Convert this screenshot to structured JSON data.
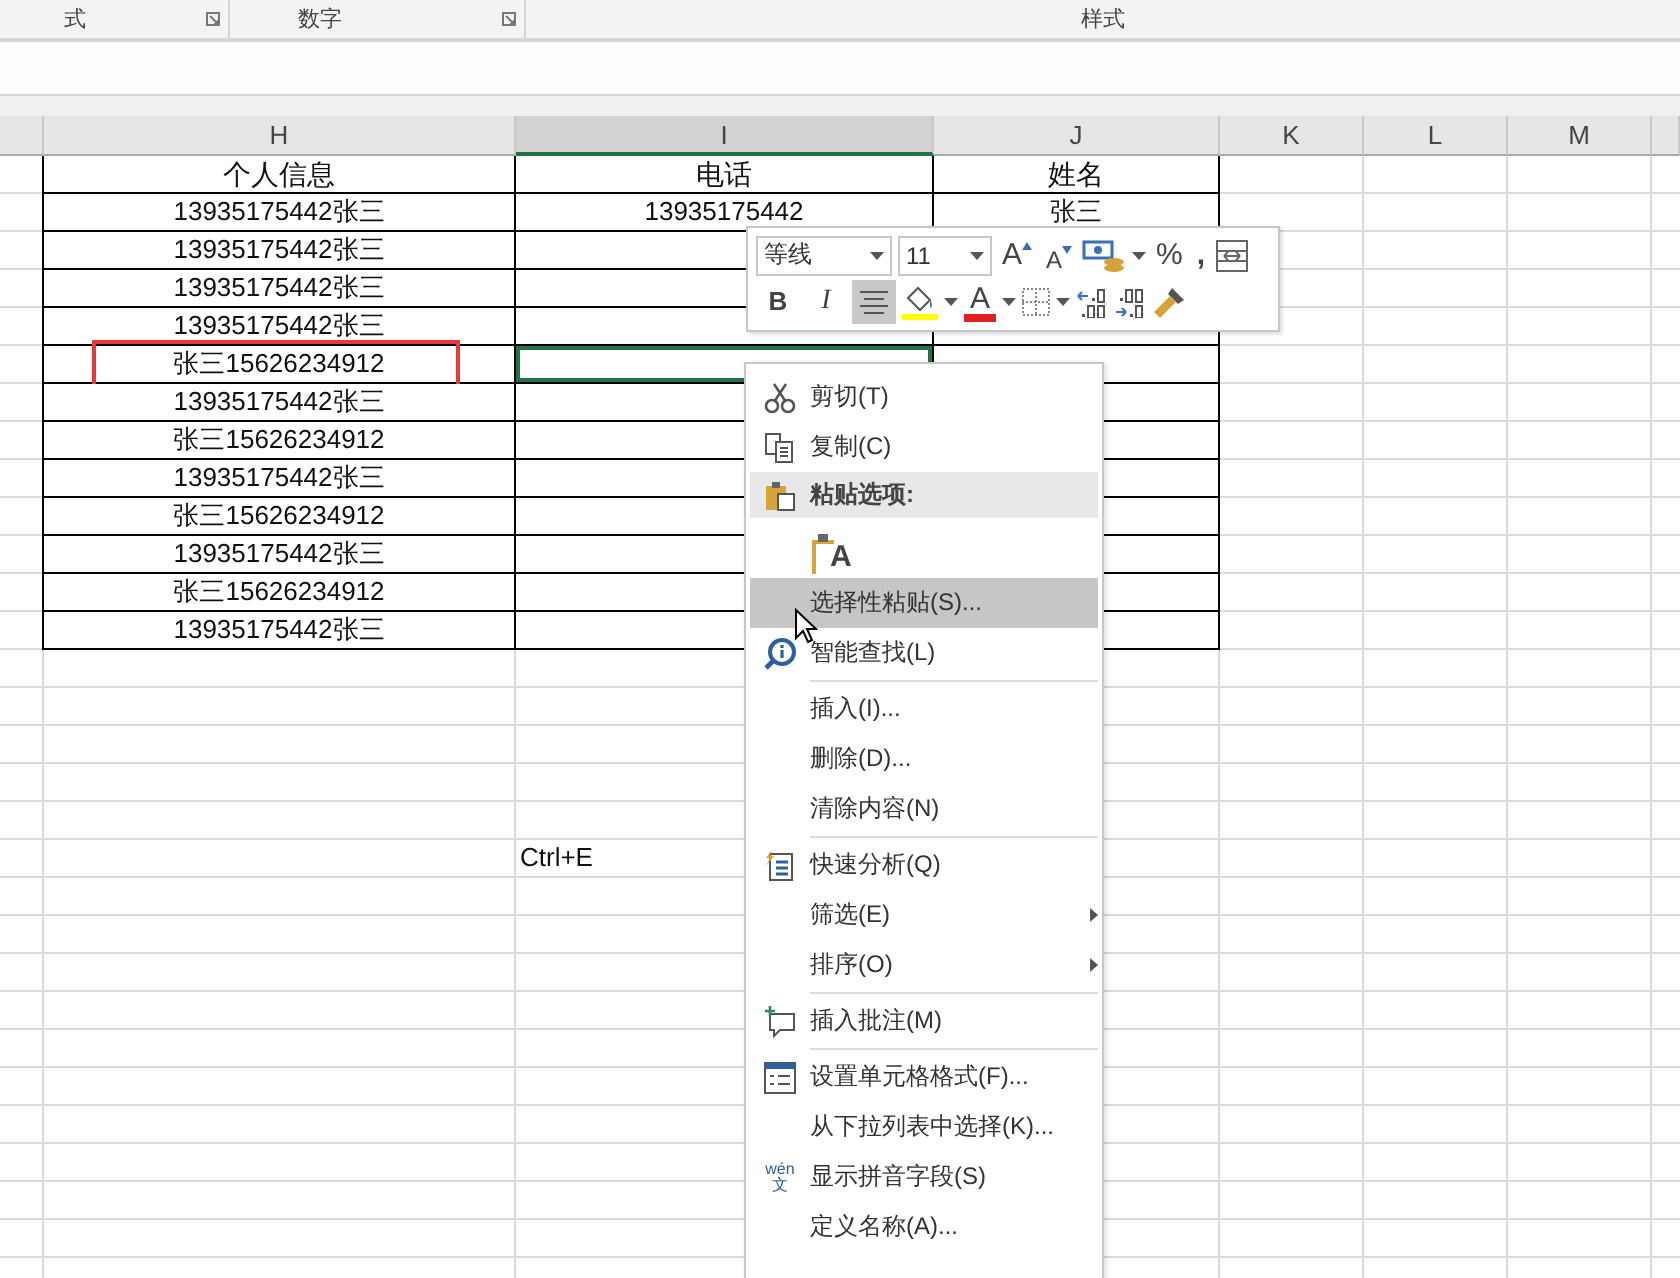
{
  "ribbon_groups": [
    {
      "label": "式"
    },
    {
      "label": "数字"
    },
    {
      "label": "样式"
    }
  ],
  "columns": [
    {
      "label": "H",
      "selected": false
    },
    {
      "label": "I",
      "selected": true
    },
    {
      "label": "J",
      "selected": false
    },
    {
      "label": "K",
      "selected": false
    },
    {
      "label": "L",
      "selected": false
    },
    {
      "label": "M",
      "selected": false
    }
  ],
  "headers": [
    "个人信息",
    "电话",
    "姓名"
  ],
  "rows": [
    {
      "personal_info": "13935175442张三",
      "phone": "13935175442",
      "name": "张三",
      "marked": false,
      "phone_selected": false
    },
    {
      "personal_info": "13935175442张三",
      "marked": false,
      "phone_selected": false
    },
    {
      "personal_info": "13935175442张三",
      "marked": false,
      "phone_selected": false
    },
    {
      "personal_info": "13935175442张三",
      "marked": false,
      "phone_selected": false
    },
    {
      "personal_info": "张三15626234912",
      "marked": true,
      "phone_selected": true
    },
    {
      "personal_info": "13935175442张三",
      "marked": false,
      "phone_selected": false
    },
    {
      "personal_info": "张三15626234912",
      "marked": false,
      "phone_selected": false
    },
    {
      "personal_info": "13935175442张三",
      "marked": false,
      "phone_selected": false
    },
    {
      "personal_info": "张三15626234912",
      "marked": false,
      "phone_selected": false
    },
    {
      "personal_info": "13935175442张三",
      "marked": false,
      "phone_selected": false
    },
    {
      "personal_info": "张三15626234912",
      "marked": false,
      "phone_selected": false
    },
    {
      "personal_info": "13935175442张三",
      "marked": false,
      "phone_selected": false
    }
  ],
  "free_cells": [
    {
      "text": "Ctrl+E"
    }
  ],
  "mini_toolbar": {
    "font": "等线",
    "size": "11",
    "grow": "A",
    "shrink": "A",
    "percent": "%",
    "comma": ",",
    "bold": "B",
    "italic": "I",
    "font_color": "A",
    "align_pressed": true
  },
  "context_menu": [
    {
      "kind": "item",
      "label": "剪切(T)",
      "highlighted": false,
      "submenu": false
    },
    {
      "kind": "item",
      "label": "复制(C)",
      "highlighted": false,
      "submenu": false
    },
    {
      "kind": "header",
      "label": "粘贴选项:"
    },
    {
      "kind": "paste_option",
      "label": "A"
    },
    {
      "kind": "item",
      "label": "选择性粘贴(S)...",
      "highlighted": true,
      "submenu": false
    },
    {
      "kind": "item",
      "label": "智能查找(L)",
      "highlighted": false,
      "submenu": false
    },
    {
      "kind": "separator"
    },
    {
      "kind": "item",
      "label": "插入(I)...",
      "highlighted": false,
      "submenu": false
    },
    {
      "kind": "item",
      "label": "删除(D)...",
      "highlighted": false,
      "submenu": false
    },
    {
      "kind": "item",
      "label": "清除内容(N)",
      "highlighted": false,
      "submenu": false
    },
    {
      "kind": "separator"
    },
    {
      "kind": "item",
      "label": "快速分析(Q)",
      "highlighted": false,
      "submenu": false
    },
    {
      "kind": "item",
      "label": "筛选(E)",
      "highlighted": false,
      "submenu": true
    },
    {
      "kind": "item",
      "label": "排序(O)",
      "highlighted": false,
      "submenu": true
    },
    {
      "kind": "separator"
    },
    {
      "kind": "item",
      "label": "插入批注(M)",
      "highlighted": false,
      "submenu": false
    },
    {
      "kind": "separator"
    },
    {
      "kind": "item",
      "label": "设置单元格格式(F)...",
      "highlighted": false,
      "submenu": false
    },
    {
      "kind": "item",
      "label": "从下拉列表中选择(K)...",
      "highlighted": false,
      "submenu": false
    },
    {
      "kind": "item",
      "label": "显示拼音字段(S)",
      "highlighted": false,
      "submenu": false,
      "icon_glyphs": [
        "wén",
        "文"
      ]
    },
    {
      "kind": "item",
      "label": "定义名称(A)...",
      "highlighted": false,
      "submenu": false
    }
  ]
}
